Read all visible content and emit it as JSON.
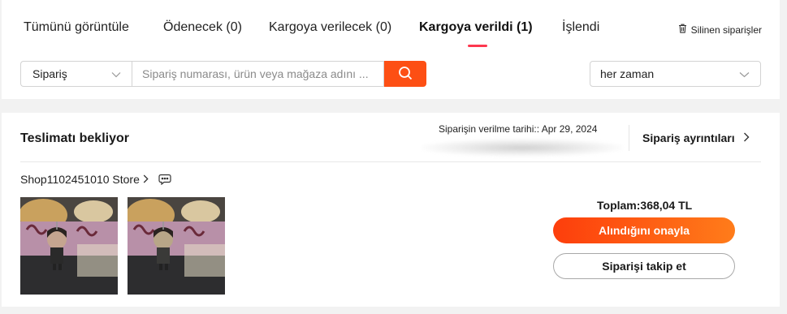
{
  "tabs": [
    {
      "label": "Tümünü görüntüle"
    },
    {
      "label": "Ödenecek (0)"
    },
    {
      "label": "Kargoya verilecek (0)"
    },
    {
      "label": "Kargoya verildi (1)",
      "active": true
    },
    {
      "label": "İşlendi"
    }
  ],
  "deleted_orders": {
    "label": "Silinen siparişler",
    "icon": "trash-icon"
  },
  "search": {
    "type_select": "Sipariş",
    "placeholder": "Sipariş numarası, ürün veya mağaza adını ...",
    "button_icon": "search-icon",
    "time_filter": "her zaman"
  },
  "order": {
    "status": "Teslimatı bekliyor",
    "date_label": "Siparişin verilme tarihi:: Apr 29, 2024",
    "details_link": "Sipariş ayrıntıları",
    "store_name": "Shop1102451010 Store",
    "chat_icon": "chat-icon",
    "products": [
      {
        "name": "product-thumbnail-1"
      },
      {
        "name": "product-thumbnail-2"
      }
    ],
    "total": "Toplam:368,04 TL",
    "confirm_button": "Alındığını onayla",
    "track_button": "Siparişi takip et"
  },
  "colors": {
    "accent": "#fd4f14",
    "tab_underline": "#fd384f",
    "confirm_gradient_start": "#fd3e0c",
    "confirm_gradient_end": "#ff7c1a"
  }
}
